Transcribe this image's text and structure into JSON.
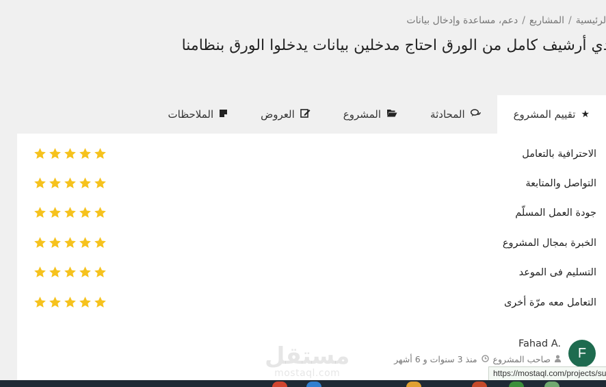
{
  "breadcrumb": {
    "items": [
      "الرئيسية",
      "المشاريع",
      "دعم، مساعدة وإدخال بيانات"
    ],
    "separator": "/"
  },
  "page": {
    "title": "لدي أرشيف كامل من الورق احتاج مدخلين بيانات يدخلوا الورق بنظامنا"
  },
  "tabs": [
    {
      "label": "تقييم المشروع",
      "icon": "star-icon",
      "active": true
    },
    {
      "label": "المحادثة",
      "icon": "comments-icon",
      "active": false
    },
    {
      "label": "المشروع",
      "icon": "folder-open-icon",
      "active": false
    },
    {
      "label": "العروض",
      "icon": "edit-icon",
      "active": false
    },
    {
      "label": "الملاحظات",
      "icon": "sticky-note-icon",
      "active": false
    }
  ],
  "ratings": [
    {
      "label": "الاحترافية بالتعامل",
      "stars": 5,
      "max": 5
    },
    {
      "label": "التواصل والمتابعة",
      "stars": 5,
      "max": 5
    },
    {
      "label": "جودة العمل المسلّم",
      "stars": 5,
      "max": 5
    },
    {
      "label": "الخبرة بمجال المشروع",
      "stars": 5,
      "max": 5
    },
    {
      "label": "التسليم فى الموعد",
      "stars": 5,
      "max": 5
    },
    {
      "label": "التعامل معه مرّة أخرى",
      "stars": 5,
      "max": 5
    }
  ],
  "reviewer": {
    "name": "Fahad A.",
    "role": "صاحب المشروع",
    "time": "منذ 3 سنوات و 6 أشهر",
    "avatar_letter": "F",
    "avatar_color": "#1e6b4f"
  },
  "watermark": {
    "brand": "مستقل",
    "domain": "mostaql.com"
  },
  "status_bar": {
    "url": "https://mostaql.com/projects/su"
  },
  "colors": {
    "star": "#f6c21d",
    "background": "#f0f0f0",
    "panel": "#ffffff"
  }
}
